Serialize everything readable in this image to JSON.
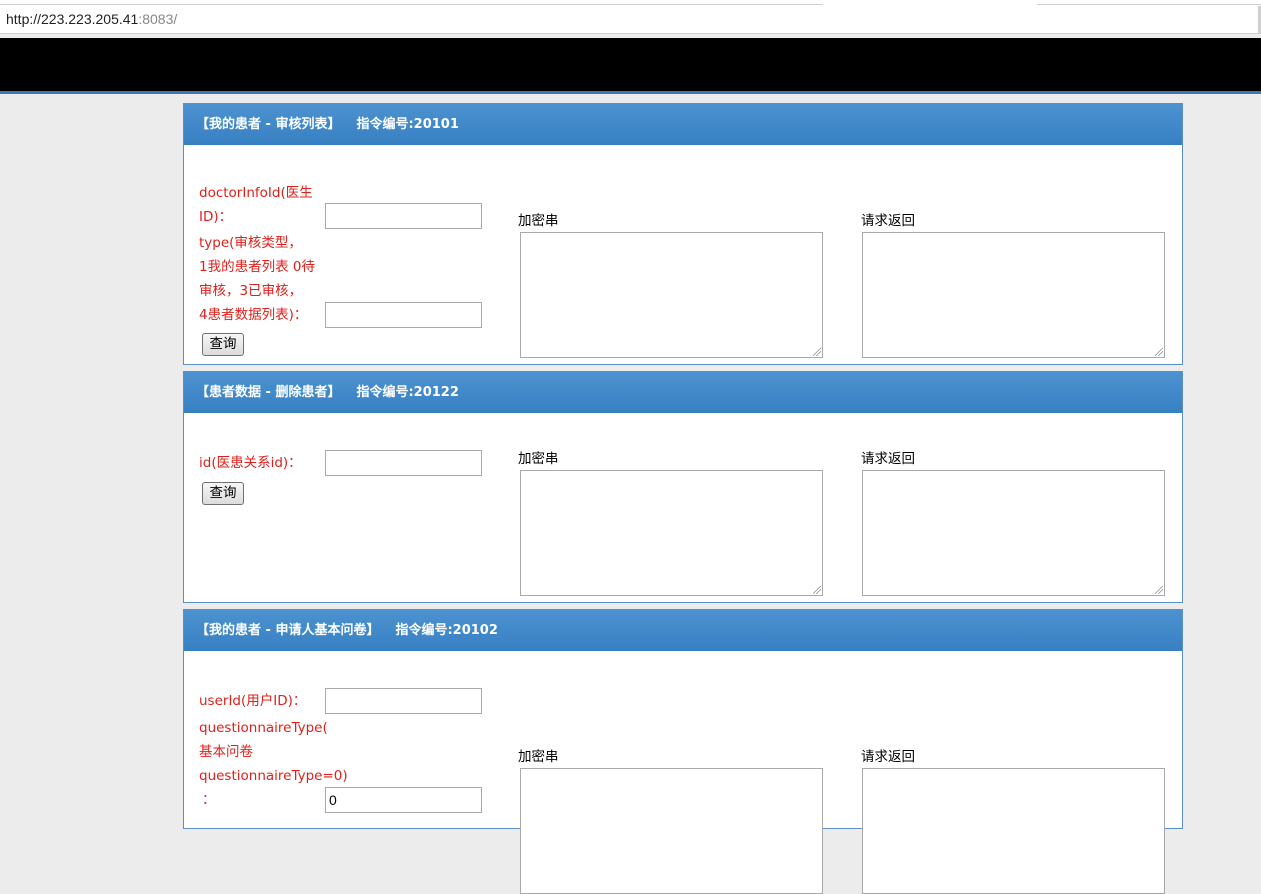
{
  "browser": {
    "url_host": "http://223.223.205.41",
    "url_port": ":8083/"
  },
  "labels": {
    "encrypted": "加密串",
    "response": "请求返回",
    "query_button": "查询"
  },
  "panels": [
    {
      "title": "【我的患者 - 审核列表】",
      "code": "指令编号:20101",
      "fields": [
        {
          "label_lines": [
            "doctorInfoId(医生",
            "ID)："
          ],
          "value": ""
        },
        {
          "label_lines": [
            "type(审核类型，",
            "1我的患者列表 0待",
            "审核，3已审核，",
            "4患者数据列表)："
          ],
          "value": ""
        }
      ]
    },
    {
      "title": "【患者数据 - 删除患者】",
      "code": "指令编号:20122",
      "fields": [
        {
          "label_lines": [
            "id(医患关系id)："
          ],
          "value": ""
        }
      ]
    },
    {
      "title": "【我的患者 - 申请人基本问卷】",
      "code": "指令编号:20102",
      "fields": [
        {
          "label_lines": [
            "userId(用户ID)："
          ],
          "value": ""
        },
        {
          "label_lines": [
            "questionnaireType(",
            "基本问卷",
            "questionnaireType=0)",
            "："
          ],
          "value": "0"
        }
      ]
    }
  ],
  "colors": {
    "header_blue": "#3680c2",
    "label_red": "#e0201b",
    "topbar": "#000000"
  }
}
